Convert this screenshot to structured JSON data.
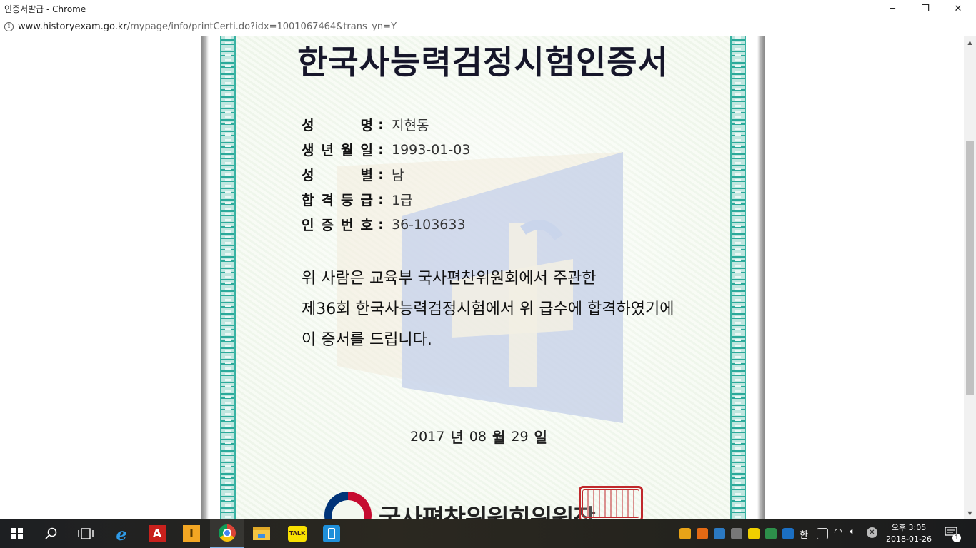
{
  "window": {
    "title": "인증서발급 - Chrome",
    "minimize": "─",
    "restore": "❐",
    "close": "✕"
  },
  "address": {
    "host": "www.historyexam.go.kr",
    "path": "/mypage/info/printCerti.do?idx=1001067464&trans_yn=Y"
  },
  "certificate": {
    "title": "한국사능력검정시험인증서",
    "fields": [
      {
        "label": [
          "성",
          "명"
        ],
        "value": "지현동"
      },
      {
        "label": [
          "생",
          "년",
          "월",
          "일"
        ],
        "value": "1993-01-03"
      },
      {
        "label": [
          "성",
          "별"
        ],
        "value": "남"
      },
      {
        "label": [
          "합",
          "격",
          "등",
          "급"
        ],
        "value": "1급"
      },
      {
        "label": [
          "인",
          "증",
          "번",
          "호"
        ],
        "value": "36-103633"
      }
    ],
    "colon": ":",
    "statement": [
      "위 사람은 교육부 국사편찬위원회에서 주관한",
      "제36회 한국사능력검정시험에서 위 급수에 합격하였기에",
      "이 증서를 드립니다."
    ],
    "date": {
      "year": "2017",
      "year_unit": "년",
      "month": "08",
      "month_unit": "월",
      "day": "29",
      "day_unit": "일"
    },
    "issuer": "국사편찬위원회위원장"
  },
  "taskbar": {
    "items": [
      "start-icon",
      "search-icon",
      "task-view-icon",
      "internet-explorer-icon",
      "acrobat-icon",
      "app-i-icon",
      "chrome-icon",
      "file-explorer-icon",
      "kakaotalk-icon",
      "app-blue-icon"
    ],
    "kakaotalk_label": "TALK",
    "clock_time": "오후 3:05",
    "clock_date": "2018-01-26",
    "ime_label": "한",
    "notification_count": "1"
  }
}
